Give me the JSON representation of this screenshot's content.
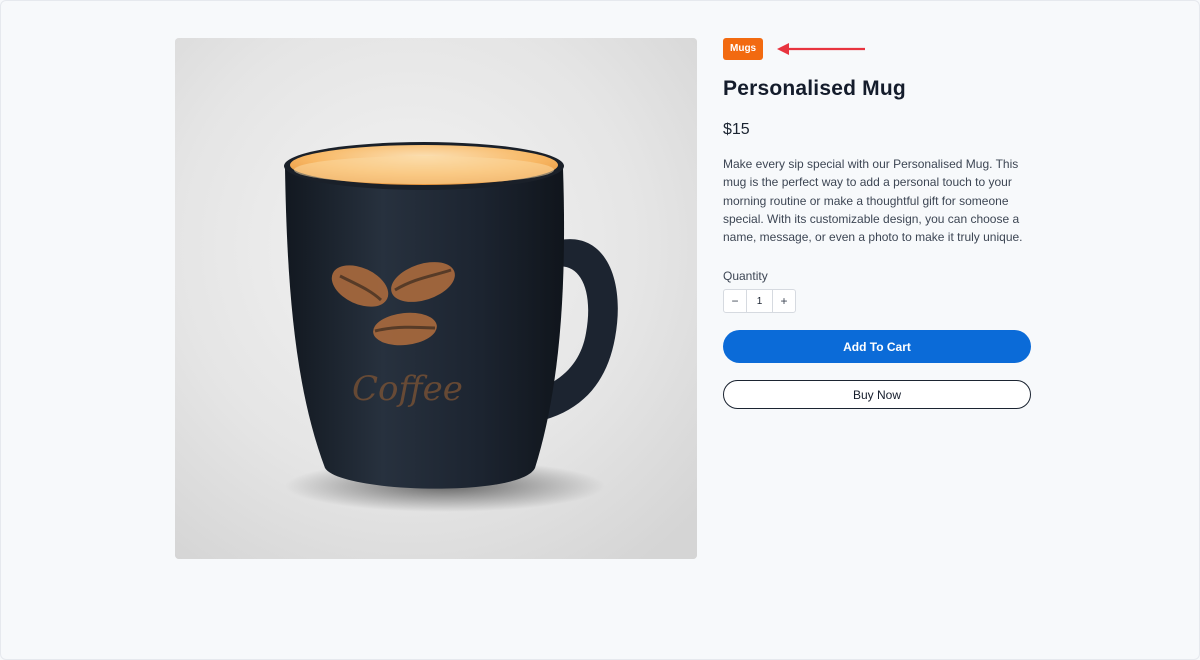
{
  "product": {
    "category_badge": "Mugs",
    "title": "Personalised Mug",
    "price": "$15",
    "description": "Make every sip special with our Personalised Mug. This mug is the perfect way to add a personal touch to your morning routine or make a thoughtful gift for someone special. With its customizable design, you can choose a name, message, or even a photo to make it truly unique.",
    "image_text": "Coffee"
  },
  "quantity": {
    "label": "Quantity",
    "value": "1",
    "decrement_symbol": "−",
    "increment_symbol": "+"
  },
  "actions": {
    "add_to_cart": "Add To Cart",
    "buy_now": "Buy Now"
  },
  "colors": {
    "badge": "#f26a10",
    "primary_button": "#0b6bd8",
    "annotation_arrow": "#e8343f",
    "mug_body": "#1f2733",
    "mug_interior": "#f7b466"
  },
  "icons": {
    "annotation": "left-arrow-icon",
    "decrement": "minus-icon",
    "increment": "plus-icon"
  }
}
